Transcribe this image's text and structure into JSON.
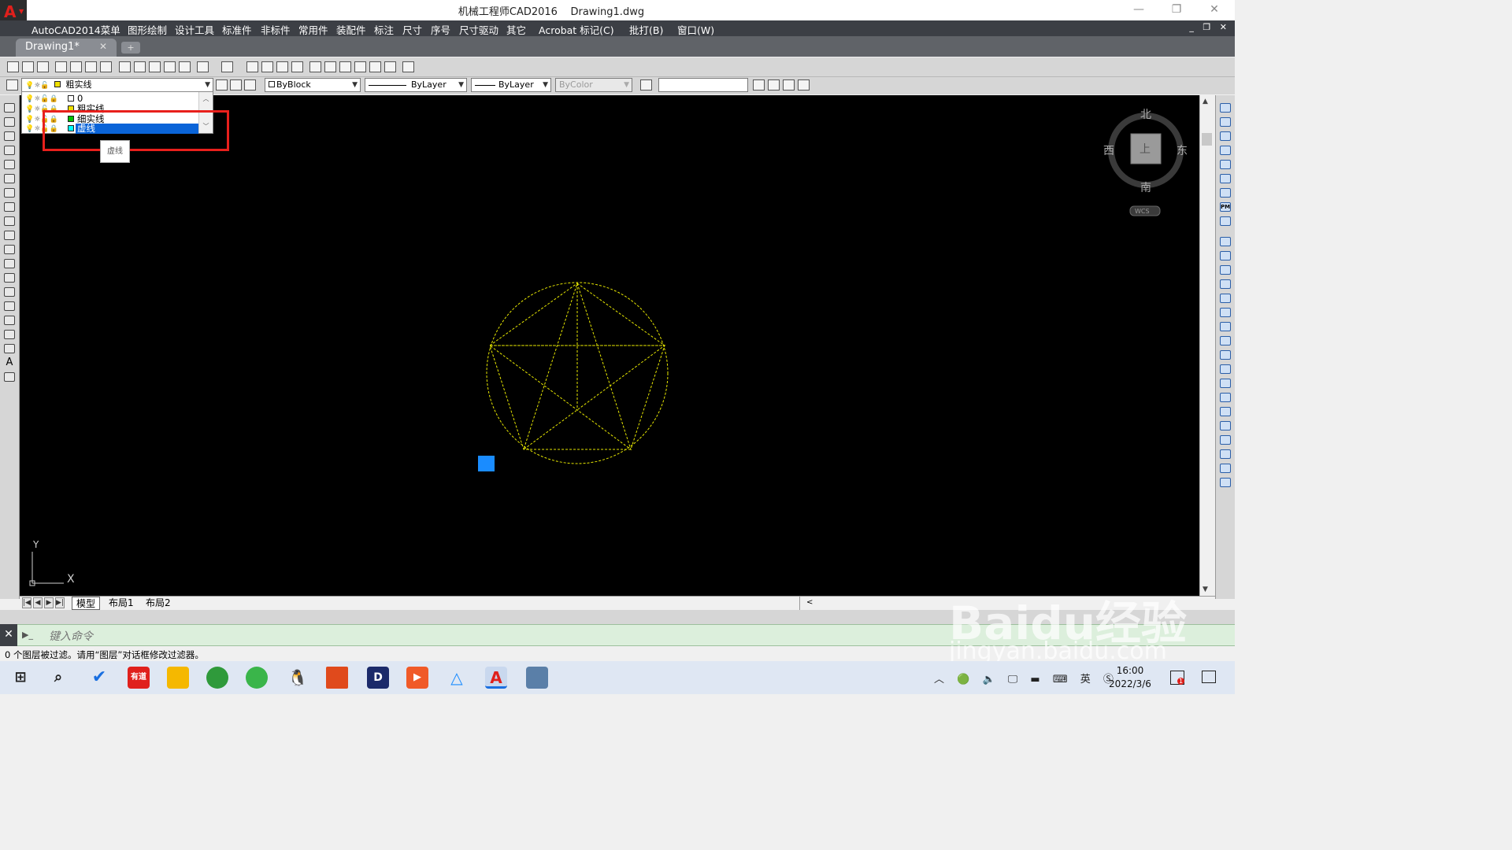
{
  "window": {
    "title": "机械工程师CAD2016    Drawing1.dwg",
    "app_icon_letter": "A",
    "minimize": "—",
    "restore": "❐",
    "close": "✕"
  },
  "menubar": {
    "items": [
      "AutoCAD2014菜单",
      "图形绘制",
      "设计工具",
      "标准件",
      "非标件",
      "常用件",
      "装配件",
      "标注",
      "尺寸",
      "序号",
      "尺寸驱动",
      "其它",
      "Acrobat 标记(C)",
      "批打(B)",
      "窗口(W)"
    ],
    "window_controls": "_ ❐ ✕"
  },
  "tabs": {
    "active": "Drawing1*",
    "close": "✕",
    "new": "+"
  },
  "properties": {
    "layer_current": "粗实线",
    "color": "ByBlock",
    "linetype": "ByLayer",
    "lineweight": "ByLayer",
    "plotstyle": "ByColor"
  },
  "layer_dropdown": {
    "rows": [
      {
        "name": "0",
        "color": "#ffffff"
      },
      {
        "name": "粗实线",
        "color": "#f0e000"
      },
      {
        "name": "细实线",
        "color": "#00c000"
      },
      {
        "name": "虚线",
        "color": "#00ffff"
      }
    ],
    "selected_index": 3,
    "tooltip": "虚线"
  },
  "viewcube": {
    "north": "北",
    "south": "南",
    "east": "东",
    "west": "西",
    "top_face": "上",
    "wcs": "WCS"
  },
  "ucs": {
    "x": "X",
    "y": "Y"
  },
  "layout_tabs": [
    "模型",
    "布局1",
    "布局2"
  ],
  "command": {
    "placeholder": "键入命令",
    "prompt_icon": "▶_"
  },
  "status_message": "0 个图层被过滤。请用“图层”对话框修改过滤器。",
  "taskbar": {
    "time": "16:00",
    "date": "2022/3/6",
    "notification_count": "1",
    "ime": "英",
    "youdao": "有道"
  },
  "watermark": {
    "brand": "Baidu经验",
    "url": "jingyan.baidu.com"
  },
  "drawing": {
    "linetype": "dashed",
    "color": "#e6e600",
    "shape": "pentagram inscribed in circle"
  }
}
